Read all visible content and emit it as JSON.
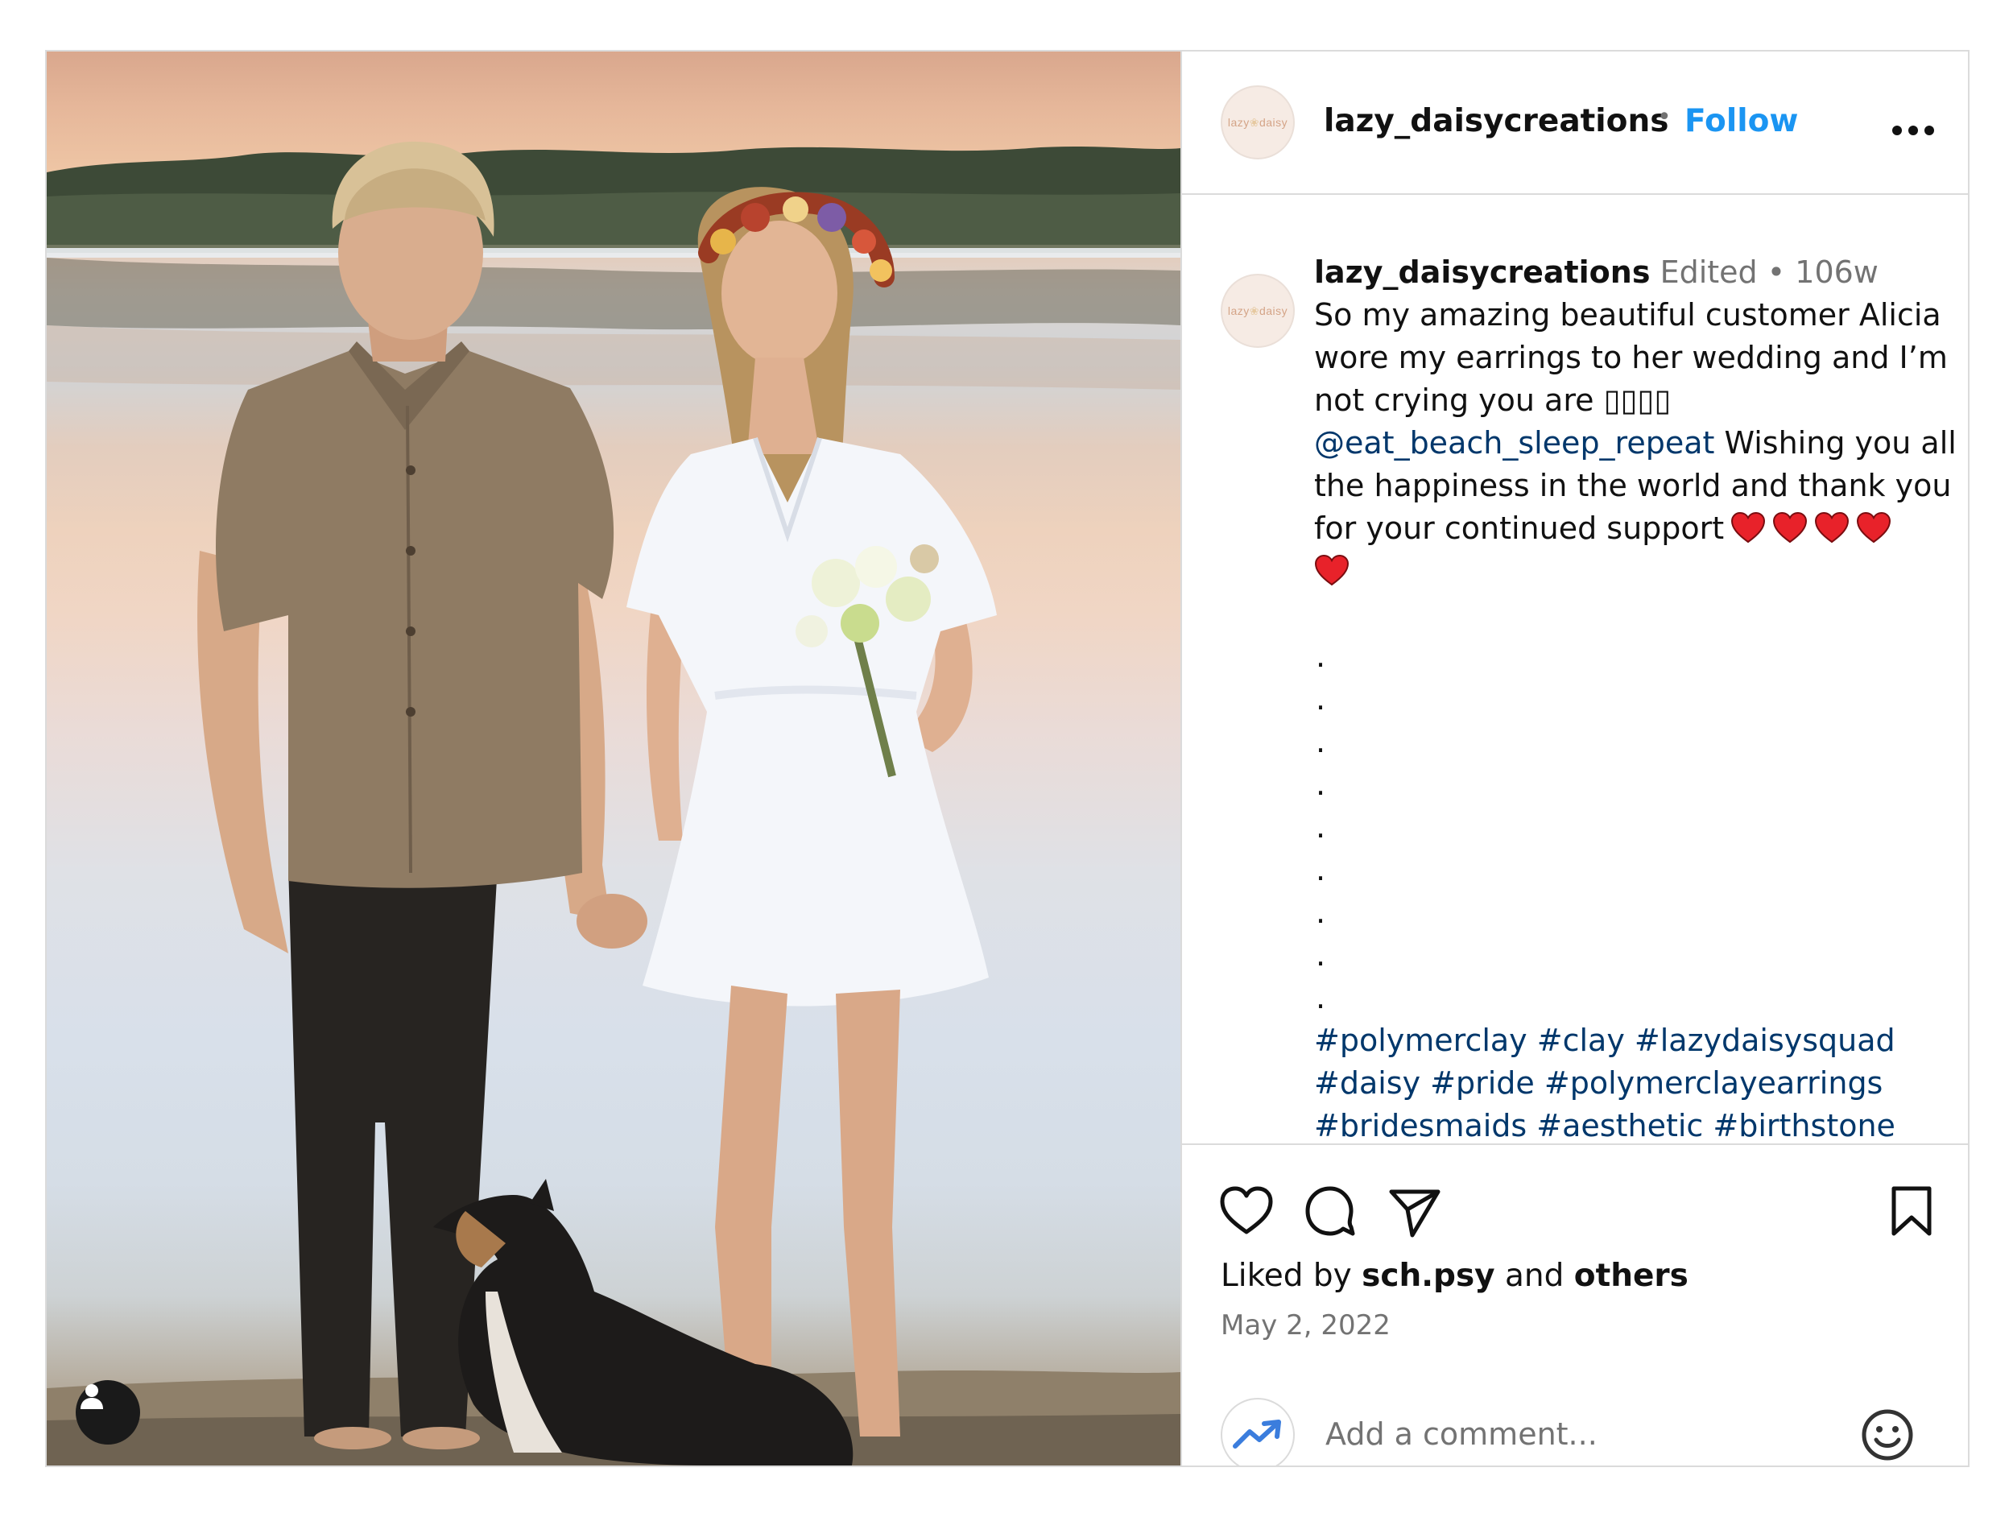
{
  "post": {
    "username": "lazy_daisycreations",
    "follow_label": "Follow",
    "separator": "•",
    "avatar_text": "lazy",
    "avatar_text_2": "daisy",
    "avatar_dot": "❀"
  },
  "caption": {
    "username": "lazy_daisycreations",
    "edited_label": "Edited",
    "meta_sep": "•",
    "age": "106w",
    "line1": "So my amazing beautiful customer Alicia",
    "line2": "wore my earrings to her wedding and I’m",
    "line3": "not crying you are ▯▯▯▯",
    "mention": "@eat_beach_sleep_repeat",
    "line4_rest": " Wishing you all",
    "line5": "the happiness in the world and thank you",
    "line6": "for your continued support",
    "dot": ".",
    "hashtags_line1": "#polymerclay #clay #lazydaisysquad",
    "hashtags_line2": "#daisy #pride #polymerclayearrings",
    "hashtags_line3": "#bridesmaids #aesthetic #birthstone"
  },
  "actions": {
    "liked_by_prefix": "Liked by ",
    "liked_by_user": "sch.psy",
    "liked_by_and": " and ",
    "liked_by_others": "others",
    "date": "May 2, 2022",
    "comment_placeholder": "Add a comment..."
  },
  "icons": {
    "like": "heart-outline-icon",
    "comment": "comment-bubble-icon",
    "share": "paper-plane-icon",
    "save": "bookmark-icon",
    "more": "more-horizontal-icon",
    "emoji": "smiley-icon",
    "account": "person-icon",
    "heart_emoji": "red-heart-icon"
  },
  "colors": {
    "link": "#00376b",
    "follow": "#1b95f2",
    "muted": "#737373",
    "border": "#dbdbdb",
    "heart_red": "#e8222a"
  }
}
